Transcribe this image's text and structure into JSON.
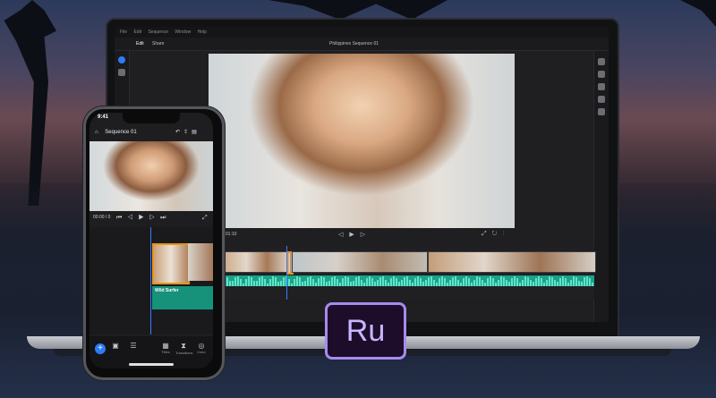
{
  "desktop": {
    "menu": [
      "File",
      "Edit",
      "Sequence",
      "Window",
      "Help"
    ],
    "tabs": [
      "Edit",
      "Share"
    ],
    "window_title": "Philippines Sequence 01",
    "timecode": "00:00:01:10"
  },
  "phone": {
    "status_time": "9:41",
    "sequence_title": "Sequence 01",
    "current_time": "00:00 / 0",
    "audio_clip_label": "Wild Surfer",
    "toolbar": [
      {
        "label": "",
        "icon": "media-icon"
      },
      {
        "label": "",
        "icon": "text-icon"
      },
      {
        "label": "Titles",
        "icon": "titles-icon"
      },
      {
        "label": "Transitions",
        "icon": "transitions-icon"
      },
      {
        "label": "Color",
        "icon": "color-icon"
      }
    ]
  },
  "logo": {
    "text": "Ru",
    "brand_color": "#a68bf0"
  },
  "colors": {
    "accent_blue": "#2d7cf6",
    "selection_orange": "#e8931a",
    "audio_teal": "#1aa389"
  }
}
